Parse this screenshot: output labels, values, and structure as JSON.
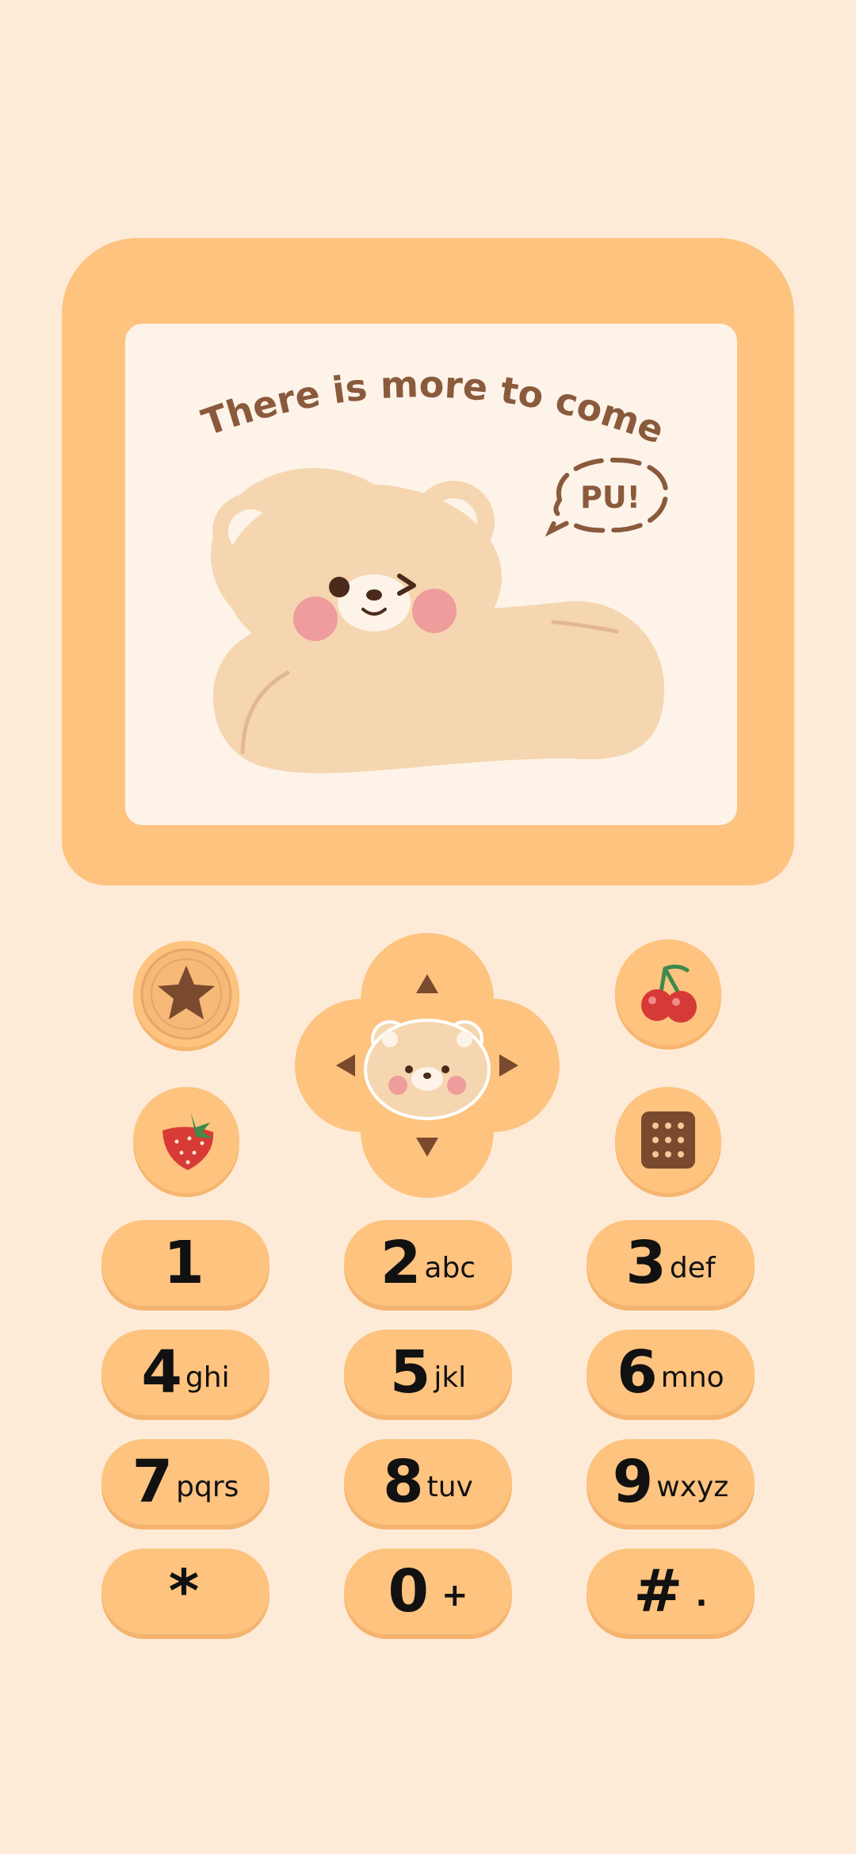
{
  "screen": {
    "headline": "There is more to come",
    "bubble_text": "PU!"
  },
  "side_buttons": [
    {
      "name": "star-coin-button",
      "icon": "star-coin-icon"
    },
    {
      "name": "cherry-button",
      "icon": "cherry-icon"
    },
    {
      "name": "strawberry-button",
      "icon": "strawberry-icon"
    },
    {
      "name": "biscuit-button",
      "icon": "biscuit-icon"
    }
  ],
  "dpad": {
    "center_icon": "bear-face-icon",
    "arrows": [
      "up-arrow-icon",
      "down-arrow-icon",
      "left-arrow-icon",
      "right-arrow-icon"
    ]
  },
  "keypad": [
    {
      "num": "1",
      "letters": ""
    },
    {
      "num": "2",
      "letters": "abc"
    },
    {
      "num": "3",
      "letters": "def"
    },
    {
      "num": "4",
      "letters": "ghi"
    },
    {
      "num": "5",
      "letters": "jkl"
    },
    {
      "num": "6",
      "letters": "mno"
    },
    {
      "num": "7",
      "letters": "pqrs"
    },
    {
      "num": "8",
      "letters": "tuv"
    },
    {
      "num": "9",
      "letters": "wxyz"
    },
    {
      "num": "*",
      "letters": ""
    },
    {
      "num": "0",
      "letters": "+"
    },
    {
      "num": "#",
      "letters": "."
    }
  ],
  "colors": {
    "background": "#fdebd8",
    "frame": "#fdc37f",
    "screen": "#fdf3e8",
    "bear": "#f5d6b0",
    "text_brown": "#8a5a3c"
  }
}
